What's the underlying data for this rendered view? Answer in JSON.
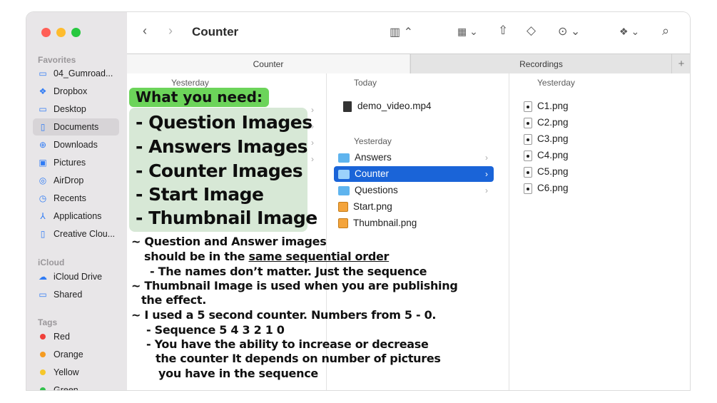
{
  "window": {
    "title": "Counter"
  },
  "sidebar": {
    "favorites_header": "Favorites",
    "favorites": [
      {
        "label": "04_Gumroad...",
        "icon": "folder-icon",
        "glyph": "▭"
      },
      {
        "label": "Dropbox",
        "icon": "dropbox-icon",
        "glyph": "❖"
      },
      {
        "label": "Desktop",
        "icon": "desktop-icon",
        "glyph": "▭"
      },
      {
        "label": "Documents",
        "icon": "document-icon",
        "glyph": "▯"
      },
      {
        "label": "Downloads",
        "icon": "download-icon",
        "glyph": "⊕"
      },
      {
        "label": "Pictures",
        "icon": "pictures-icon",
        "glyph": "▣"
      },
      {
        "label": "AirDrop",
        "icon": "airdrop-icon",
        "glyph": "◎"
      },
      {
        "label": "Recents",
        "icon": "clock-icon",
        "glyph": "◷"
      },
      {
        "label": "Applications",
        "icon": "applications-icon",
        "glyph": "⅄"
      },
      {
        "label": "Creative Clou...",
        "icon": "file-icon",
        "glyph": "▯"
      }
    ],
    "icloud_header": "iCloud",
    "icloud": [
      {
        "label": "iCloud Drive",
        "icon": "cloud-icon",
        "glyph": "☁"
      },
      {
        "label": "Shared",
        "icon": "shared-folder-icon",
        "glyph": "▭"
      }
    ],
    "tags_header": "Tags",
    "tags": [
      {
        "label": "Red",
        "color": "#f0403a"
      },
      {
        "label": "Orange",
        "color": "#f59b21"
      },
      {
        "label": "Yellow",
        "color": "#f6c72b"
      },
      {
        "label": "Green",
        "color": "#33c24d"
      }
    ]
  },
  "tabs": [
    {
      "label": "Counter",
      "active": true
    },
    {
      "label": "Recordings",
      "active": false
    }
  ],
  "columns": {
    "col1_header": "Yesterday",
    "col2_header_today": "Today",
    "col2_today_items": [
      {
        "label": "demo_video.mp4",
        "kind": "video"
      }
    ],
    "col2_header_yesterday": "Yesterday",
    "col2_items": [
      {
        "label": "Answers",
        "kind": "folder",
        "chevron": "›"
      },
      {
        "label": "Counter",
        "kind": "folder",
        "chevron": "›",
        "selected": true
      },
      {
        "label": "Questions",
        "kind": "folder",
        "chevron": "›"
      },
      {
        "label": "Start.png",
        "kind": "png"
      },
      {
        "label": "Thumbnail.png",
        "kind": "png"
      }
    ],
    "col3_header": "Yesterday",
    "col3_items": [
      "C1.png",
      "C2.png",
      "C3.png",
      "C4.png",
      "C5.png",
      "C6.png"
    ]
  },
  "overlay": {
    "title": "What you need:",
    "items": [
      "- Question Images",
      "- Answers Images",
      "- Counter Images",
      "- Start Image",
      "- Thumbnail Image"
    ],
    "notes": {
      "n1": "~ Question and Answer images",
      "n2_a": "should be in the ",
      "n2_b": "same sequential order",
      "n3": "- The names don’t matter. Just the sequence",
      "n4": "~ Thumbnail Image is used when you are publishing",
      "n5": "the effect.",
      "n6": "~ I used a 5 second counter. Numbers from 5 - 0.",
      "n7": "- Sequence 5 4 3 2 1 0",
      "n8": "- You have the ability to increase or decrease",
      "n9": "the counter  It depends on number of pictures",
      "n10": "you have in the sequence"
    }
  },
  "colors": {
    "traffic_red": "#ff5f57",
    "traffic_yellow": "#febc2e",
    "traffic_green": "#28c840",
    "selection": "#1a64d8",
    "overlay_green": "#6cd45a",
    "overlay_box": "#d7e8d6"
  }
}
